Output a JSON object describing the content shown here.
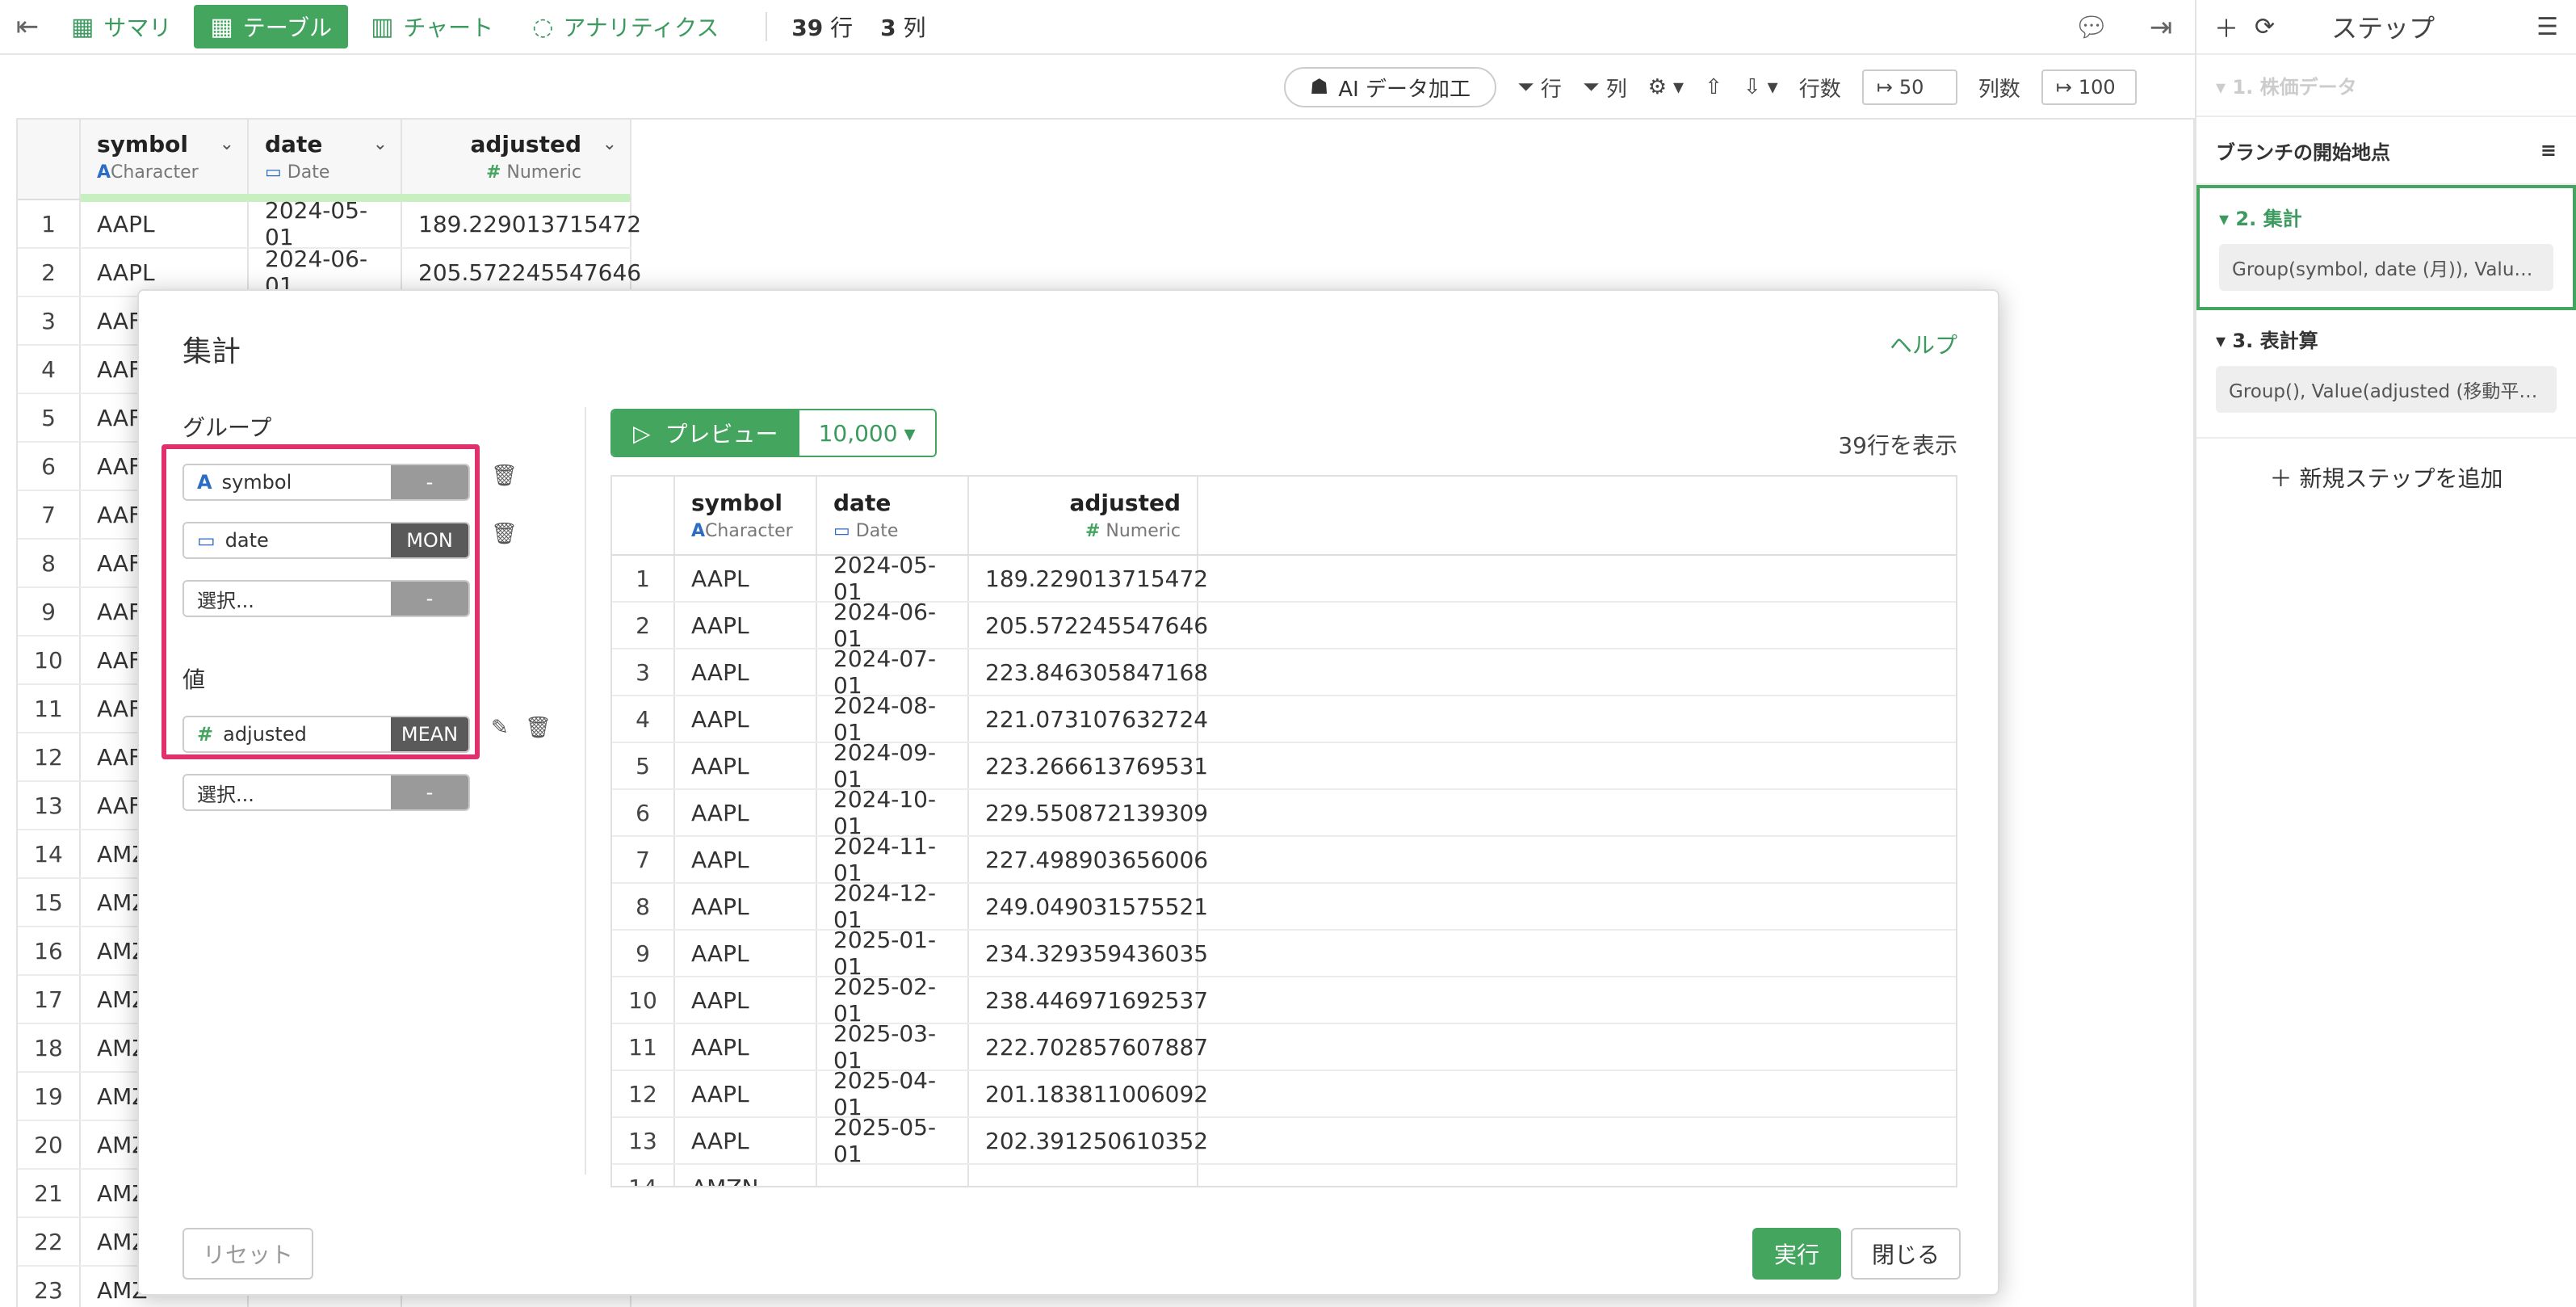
{
  "topbar": {
    "tabs": [
      {
        "label": "サマリ",
        "icon": "table-outline-icon"
      },
      {
        "label": "テーブル",
        "icon": "table-icon"
      },
      {
        "label": "チャート",
        "icon": "bar-chart-icon"
      },
      {
        "label": "アナリティクス",
        "icon": "lightbulb-icon"
      }
    ],
    "rows_count": "39",
    "rows_unit": "行",
    "cols_count": "3",
    "cols_unit": "列"
  },
  "toolbar": {
    "ai_label": "AI データ加工",
    "filter_row": "行",
    "filter_col": "列",
    "rows_label": "行数",
    "rows_value": "50",
    "cols_label": "列数",
    "cols_value": "100"
  },
  "columns": [
    {
      "name": "symbol",
      "type": "Character"
    },
    {
      "name": "date",
      "type": "Date"
    },
    {
      "name": "adjusted",
      "type": "Numeric"
    }
  ],
  "bg_rows": [
    {
      "num": "1",
      "symbol": "AAPL",
      "date": "2024-05-01",
      "adjusted": "189.229013715472"
    },
    {
      "num": "2",
      "symbol": "AAPL",
      "date": "2024-06-01",
      "adjusted": "205.572245547646"
    },
    {
      "num": "3",
      "symbol": "AAF",
      "date": "",
      "adjusted": ""
    },
    {
      "num": "4",
      "symbol": "AAF",
      "date": "",
      "adjusted": ""
    },
    {
      "num": "5",
      "symbol": "AAF",
      "date": "",
      "adjusted": ""
    },
    {
      "num": "6",
      "symbol": "AAF",
      "date": "",
      "adjusted": ""
    },
    {
      "num": "7",
      "symbol": "AAF",
      "date": "",
      "adjusted": ""
    },
    {
      "num": "8",
      "symbol": "AAF",
      "date": "",
      "adjusted": ""
    },
    {
      "num": "9",
      "symbol": "AAF",
      "date": "",
      "adjusted": ""
    },
    {
      "num": "10",
      "symbol": "AAF",
      "date": "",
      "adjusted": ""
    },
    {
      "num": "11",
      "symbol": "AAF",
      "date": "",
      "adjusted": ""
    },
    {
      "num": "12",
      "symbol": "AAF",
      "date": "",
      "adjusted": ""
    },
    {
      "num": "13",
      "symbol": "AAF",
      "date": "",
      "adjusted": ""
    },
    {
      "num": "14",
      "symbol": "AMZ",
      "date": "",
      "adjusted": ""
    },
    {
      "num": "15",
      "symbol": "AMZ",
      "date": "",
      "adjusted": ""
    },
    {
      "num": "16",
      "symbol": "AMZ",
      "date": "",
      "adjusted": ""
    },
    {
      "num": "17",
      "symbol": "AMZ",
      "date": "",
      "adjusted": ""
    },
    {
      "num": "18",
      "symbol": "AMZ",
      "date": "",
      "adjusted": ""
    },
    {
      "num": "19",
      "symbol": "AMZ",
      "date": "",
      "adjusted": ""
    },
    {
      "num": "20",
      "symbol": "AMZ",
      "date": "",
      "adjusted": ""
    },
    {
      "num": "21",
      "symbol": "AMZ",
      "date": "",
      "adjusted": ""
    },
    {
      "num": "22",
      "symbol": "AMZ",
      "date": "",
      "adjusted": ""
    },
    {
      "num": "23",
      "symbol": "AMZ",
      "date": "",
      "adjusted": ""
    }
  ],
  "right_panel": {
    "title": "ステップ",
    "step0": "1. 株価データ",
    "branch": "ブランチの開始地点",
    "step1_title": "2. 集計",
    "step1_formula": "Group(symbol, date (月)), Value(adj...",
    "step2_title": "3. 表計算",
    "step2_formula": "Group(), Value(adjusted (移動平均))",
    "add_step": "新規ステップを追加"
  },
  "dialog": {
    "title": "集計",
    "help": "ヘルプ",
    "group_label": "グループ",
    "value_label": "値",
    "group_fields": [
      {
        "name": "symbol",
        "agg": "-"
      },
      {
        "name": "date",
        "agg": "MON"
      },
      {
        "name": "選択...",
        "agg": "-"
      }
    ],
    "value_fields": [
      {
        "name": "adjusted",
        "agg": "MEAN"
      },
      {
        "name": "選択...",
        "agg": "-"
      }
    ],
    "preview_label": "プレビュー",
    "preview_count": "10,000",
    "rows_shown": "39行を表示",
    "reset": "リセット",
    "run": "実行",
    "close": "閉じる",
    "preview_rows": [
      {
        "num": "1",
        "symbol": "AAPL",
        "date": "2024-05-01",
        "adjusted": "189.229013715472"
      },
      {
        "num": "2",
        "symbol": "AAPL",
        "date": "2024-06-01",
        "adjusted": "205.572245547646"
      },
      {
        "num": "3",
        "symbol": "AAPL",
        "date": "2024-07-01",
        "adjusted": "223.846305847168"
      },
      {
        "num": "4",
        "symbol": "AAPL",
        "date": "2024-08-01",
        "adjusted": "221.073107632724"
      },
      {
        "num": "5",
        "symbol": "AAPL",
        "date": "2024-09-01",
        "adjusted": "223.266613769531"
      },
      {
        "num": "6",
        "symbol": "AAPL",
        "date": "2024-10-01",
        "adjusted": "229.550872139309"
      },
      {
        "num": "7",
        "symbol": "AAPL",
        "date": "2024-11-01",
        "adjusted": "227.498903656006"
      },
      {
        "num": "8",
        "symbol": "AAPL",
        "date": "2024-12-01",
        "adjusted": "249.049031575521"
      },
      {
        "num": "9",
        "symbol": "AAPL",
        "date": "2025-01-01",
        "adjusted": "234.329359436035"
      },
      {
        "num": "10",
        "symbol": "AAPL",
        "date": "2025-02-01",
        "adjusted": "238.446971692537"
      },
      {
        "num": "11",
        "symbol": "AAPL",
        "date": "2025-03-01",
        "adjusted": "222.702857607887"
      },
      {
        "num": "12",
        "symbol": "AAPL",
        "date": "2025-04-01",
        "adjusted": "201.183811006092"
      },
      {
        "num": "13",
        "symbol": "AAPL",
        "date": "2025-05-01",
        "adjusted": "202.391250610352"
      },
      {
        "num": "14",
        "symbol": "AMZN",
        "date": "",
        "adjusted": ""
      }
    ]
  },
  "colors": {
    "accent": "#44a55f",
    "highlight": "#e0306e"
  }
}
